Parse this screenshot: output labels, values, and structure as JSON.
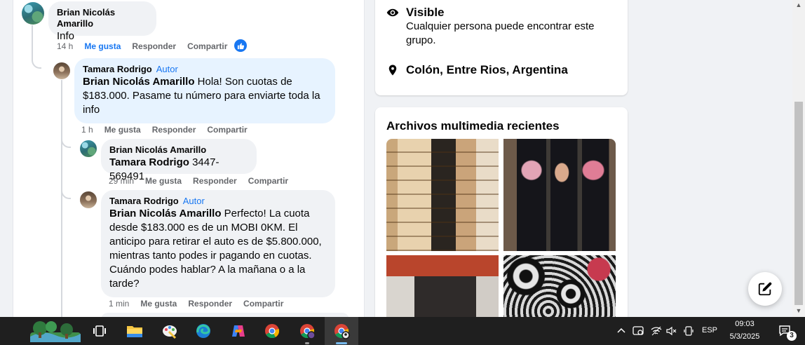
{
  "comments": [
    {
      "author": "Brian Nicolás Amarillo",
      "badge": "",
      "mention": "",
      "text": "Info",
      "time": "14 h",
      "like": "Me gusta",
      "reply": "Responder",
      "share": "Compartir"
    },
    {
      "author": "Tamara Rodrigo",
      "badge": "Autor",
      "mention": "Brian Nicolás Amarillo",
      "text": " Hola! Son cuotas de $183.000. Pasame tu número para enviarte toda la info",
      "time": "1 h",
      "like": "Me gusta",
      "reply": "Responder",
      "share": "Compartir"
    },
    {
      "author": "Brian Nicolás Amarillo",
      "badge": "",
      "mention": "Tamara Rodrigo",
      "text": " 3447-569491",
      "time": "29 min",
      "like": "Me gusta",
      "reply": "Responder",
      "share": "Compartir"
    },
    {
      "author": "Tamara Rodrigo",
      "badge": "Autor",
      "mention": "Brian Nicolás Amarillo",
      "text": " Perfecto! La cuota desde $183.000 es de un MOBI 0KM. El anticipo para retirar el auto es de $5.800.000, mientras tanto podes ir pagando en cuotas. Cuándo podes hablar? A la mañana o a la tarde?",
      "time": "1 min",
      "like": "Me gusta",
      "reply": "Responder",
      "share": "Compartir"
    }
  ],
  "about": {
    "visible_title": "Visible",
    "visible_desc": "Cualquier persona puede encontrar este grupo.",
    "location": "Colón, Entre Rios, Argentina"
  },
  "media": {
    "title": "Archivos multimedia recientes"
  },
  "taskbar": {
    "language": "ESP",
    "time": "09:03",
    "date": "5/3/2025",
    "notifications": "3"
  },
  "colors": {
    "accent": "#1877f2",
    "author_bubble": "#e7f3ff",
    "bubble": "#f0f2f5",
    "taskbar": "#1f1f1f"
  },
  "icons": [
    "eye-icon",
    "location-pin-icon",
    "like-thumb-icon",
    "compose-icon",
    "start-icon",
    "task-view-icon",
    "file-explorer-icon",
    "edge-icon",
    "copilot-icon",
    "chrome-icon",
    "wifi-icon",
    "mute-icon",
    "notification-icon"
  ]
}
